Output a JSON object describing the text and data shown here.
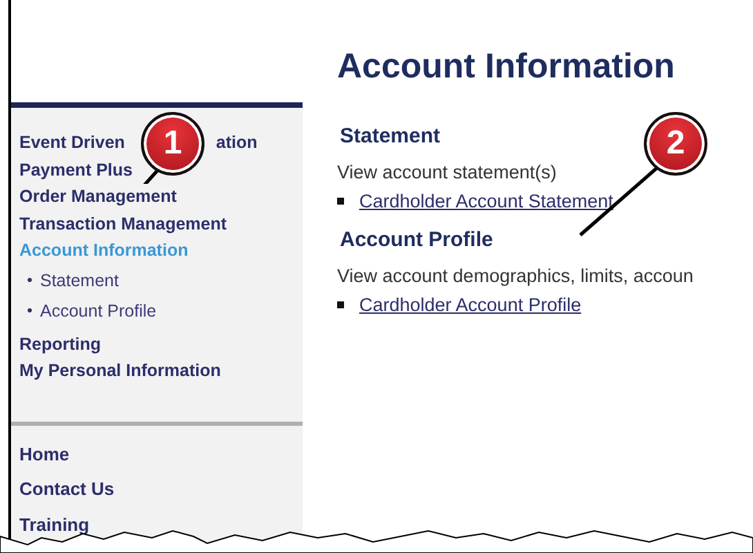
{
  "sidebar": {
    "items": [
      {
        "label": "Event Driven",
        "label_tail": "ation",
        "selected": false
      },
      {
        "label": "Payment Plus",
        "selected": false
      },
      {
        "label": "Order Management",
        "selected": false
      },
      {
        "label": "Transaction Management",
        "selected": false
      },
      {
        "label": "Account Information",
        "selected": true,
        "children": [
          {
            "label": "Statement",
            "selected": false
          },
          {
            "label": "Account Profile",
            "selected": false
          }
        ]
      },
      {
        "label": "Reporting",
        "selected": false
      },
      {
        "label": "My Personal Information",
        "selected": false
      }
    ],
    "footer_links": [
      "Home",
      "Contact Us",
      "Training"
    ]
  },
  "main": {
    "title": "Account Information",
    "sections": [
      {
        "heading": "Statement",
        "description": "View account statement(s)",
        "links": [
          "Cardholder Account Statement"
        ]
      },
      {
        "heading": "Account Profile",
        "description": "View account demographics, limits, accoun",
        "links": [
          "Cardholder Account Profile"
        ]
      }
    ]
  },
  "callouts": [
    {
      "number": "1"
    },
    {
      "number": "2"
    }
  ]
}
